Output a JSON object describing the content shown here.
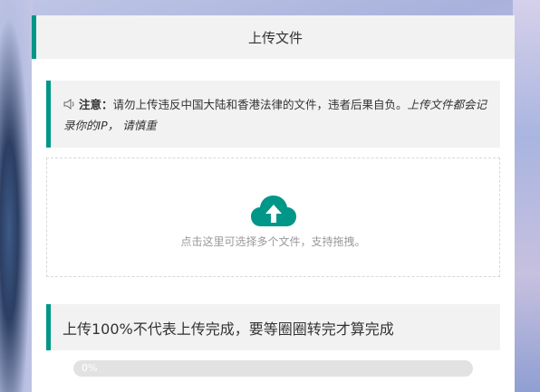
{
  "header": {
    "title": "上传文件"
  },
  "notice": {
    "label": "注意：",
    "text": "请勿上传违反中国大陆和香港法律的文件，违者后果自负。",
    "warning_italic": "上传文件都会记录你的IP， 请慎重",
    "icon": "speaker-icon"
  },
  "dropzone": {
    "icon": "cloud-upload-icon",
    "hint": "点击这里可选择多个文件，支持拖拽。"
  },
  "upload_message": "上传100%不代表上传完成，要等圈圈转完才算完成",
  "progress": {
    "percent": 0,
    "label": "0%"
  },
  "colors": {
    "accent": "#009688",
    "panel_bg": "#f2f2f2"
  }
}
